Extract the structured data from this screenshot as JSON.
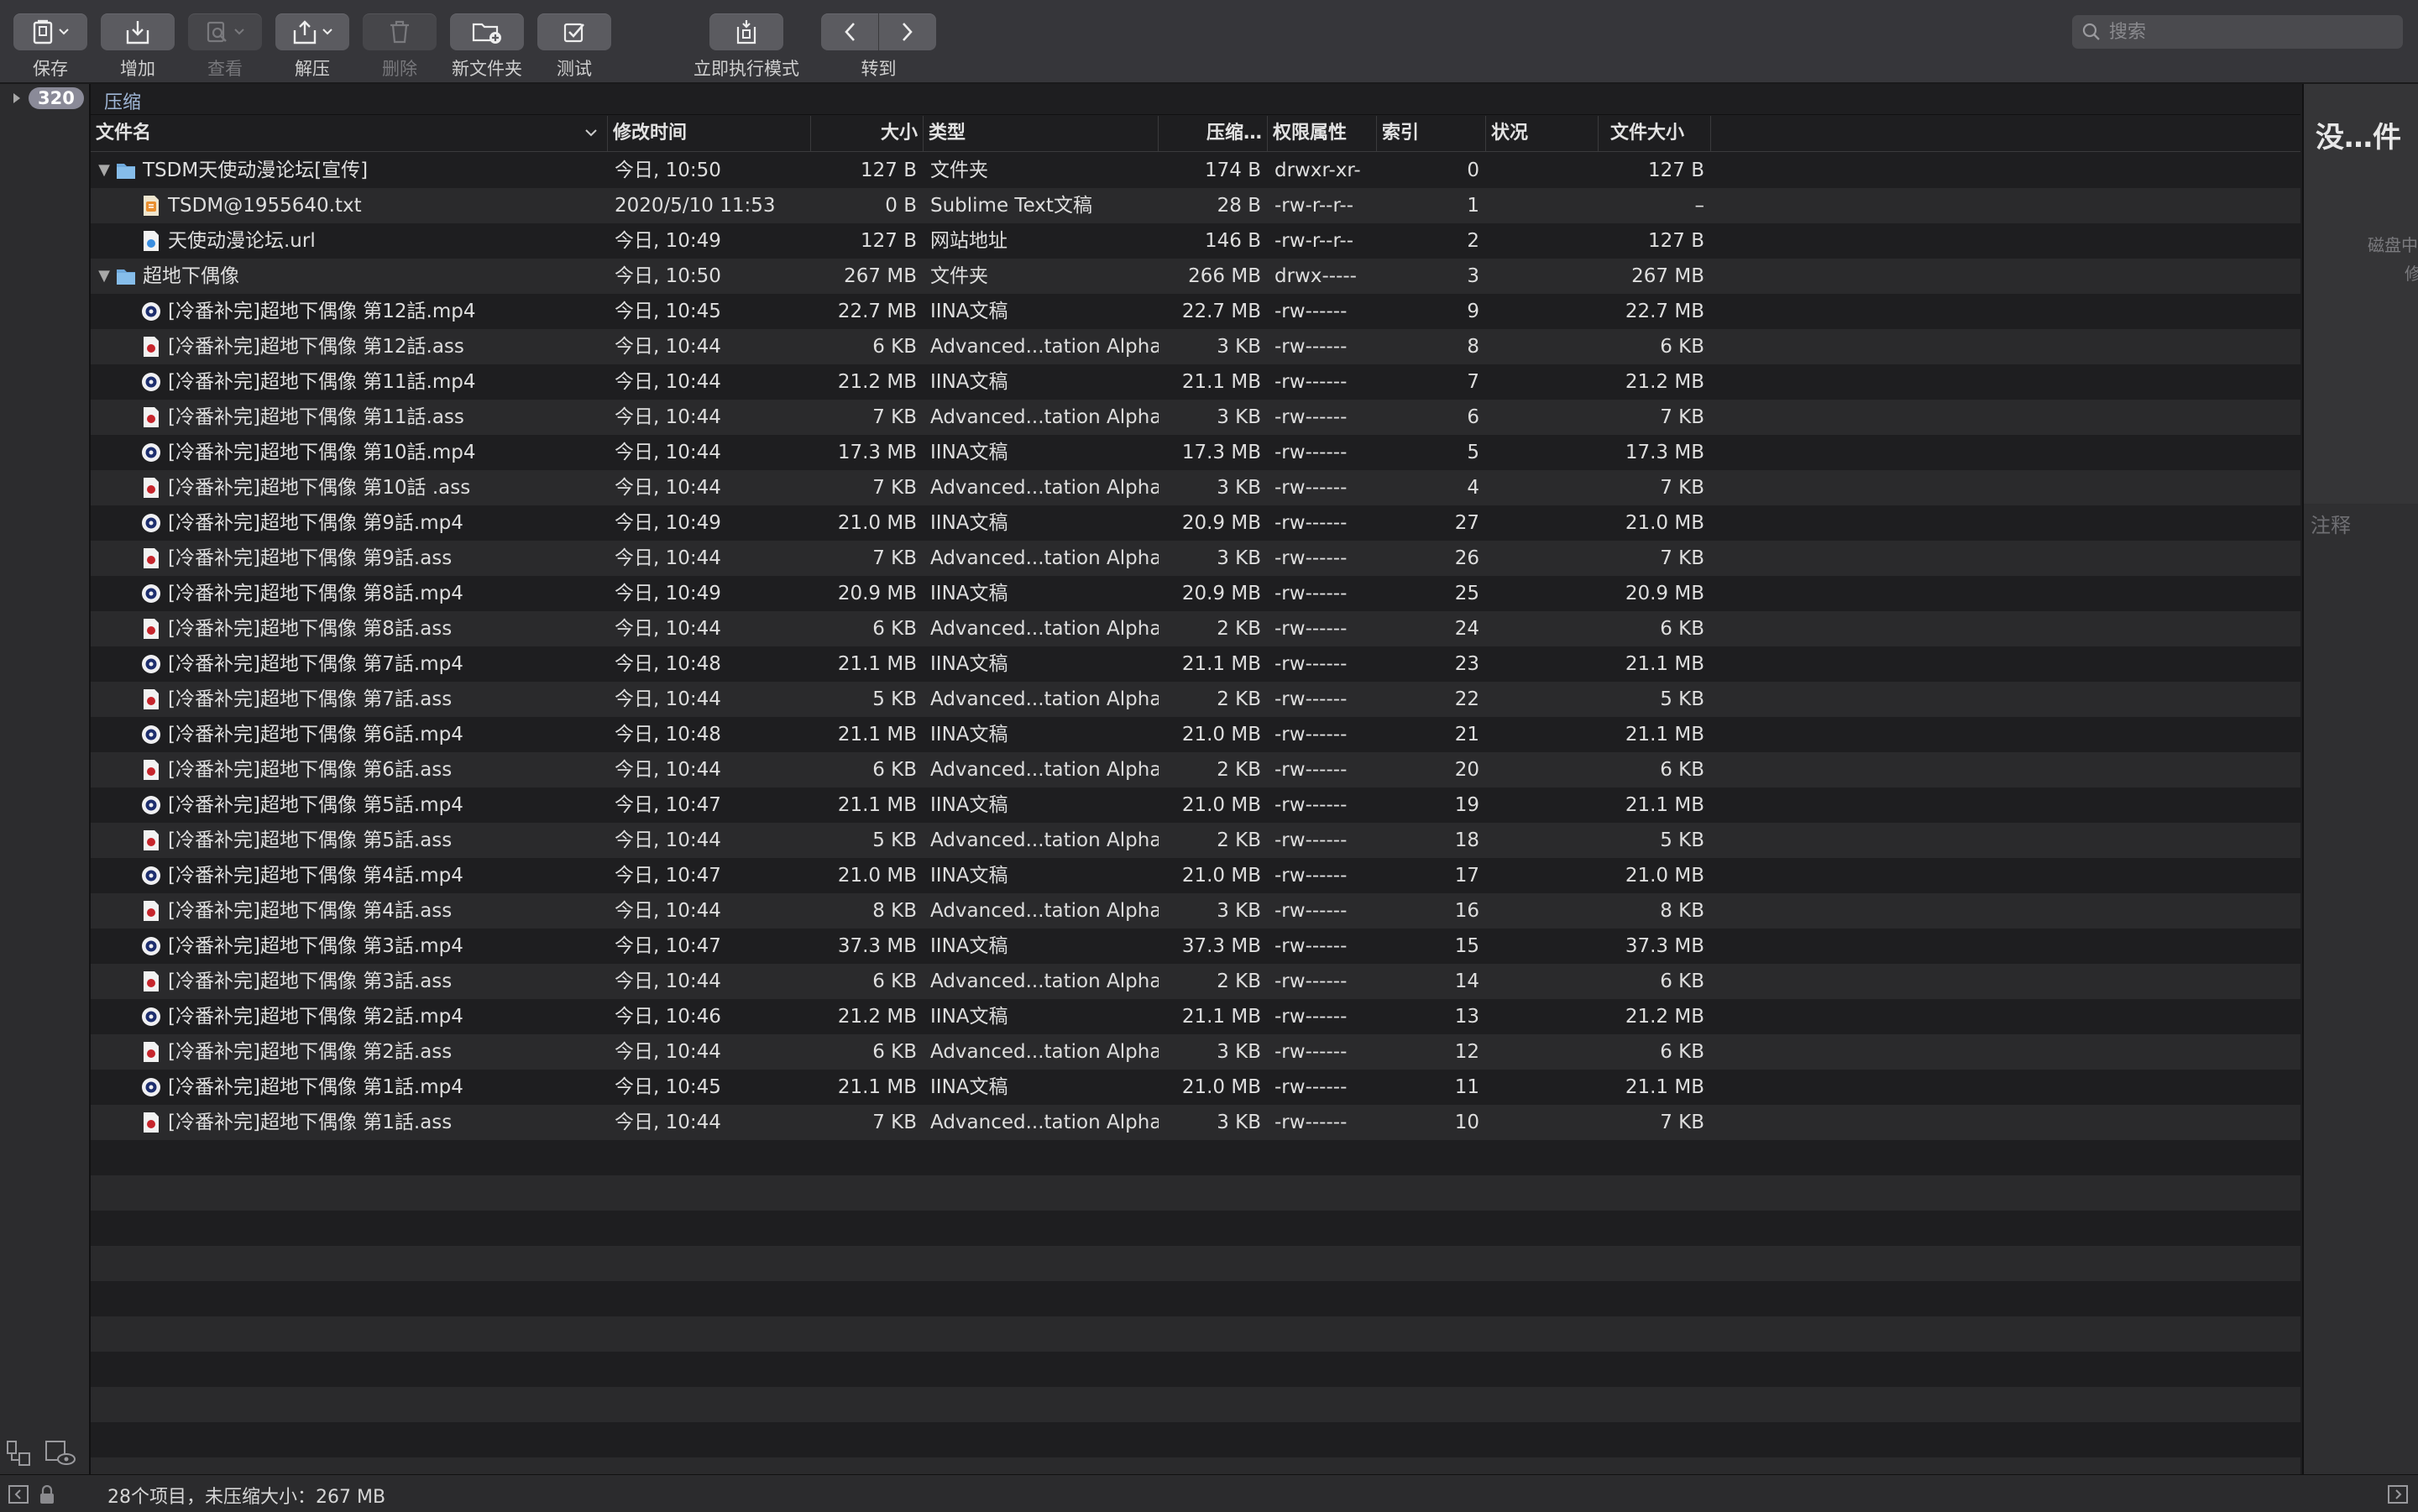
{
  "toolbar": {
    "save": "保存",
    "add": "增加",
    "view": "查看",
    "extract": "解压",
    "delete": "删除",
    "new_folder": "新文件夹",
    "test": "测试",
    "execute_mode": "立即执行模式",
    "goto": "转到"
  },
  "search": {
    "placeholder": "搜索"
  },
  "sidebar": {
    "badge": "320"
  },
  "breadcrumb": "压缩",
  "columns": {
    "name": "文件名",
    "modified": "修改时间",
    "size": "大小",
    "kind": "类型",
    "compressed": "压缩…",
    "permissions": "权限属性",
    "index": "索引",
    "status": "状况",
    "file_size": "文件大小"
  },
  "rows": [
    {
      "name": "TSDM天使动漫论坛[宣传]",
      "level": 0,
      "icon": "folder-icon",
      "expanded": true,
      "modified": "今日, 10:50",
      "size": "127 B",
      "kind": "文件夹",
      "compressed": "174 B",
      "perm": "drwxr-xr-",
      "index": "0",
      "status": "",
      "fsize": "127 B"
    },
    {
      "name": "TSDM@1955640.txt",
      "level": 1,
      "icon": "text-file-icon",
      "modified": "2020/5/10 11:53",
      "size": "0 B",
      "kind": "Sublime Text文稿",
      "compressed": "28 B",
      "perm": "-rw-r--r--",
      "index": "1",
      "status": "",
      "fsize": "–"
    },
    {
      "name": "天使动漫论坛.url",
      "level": 1,
      "icon": "url-file-icon",
      "modified": "今日, 10:49",
      "size": "127 B",
      "kind": "网站地址",
      "compressed": "146 B",
      "perm": "-rw-r--r--",
      "index": "2",
      "status": "",
      "fsize": "127 B"
    },
    {
      "name": "超地下偶像",
      "level": 0,
      "icon": "folder-icon",
      "expanded": true,
      "modified": "今日, 10:50",
      "size": "267 MB",
      "kind": "文件夹",
      "compressed": "266 MB",
      "perm": "drwx-----",
      "index": "3",
      "status": "",
      "fsize": "267 MB"
    },
    {
      "name": "[冷番补完]超地下偶像 第12話.mp4",
      "level": 1,
      "icon": "video-file-icon",
      "modified": "今日, 10:45",
      "size": "22.7 MB",
      "kind": "IINA文稿",
      "compressed": "22.7 MB",
      "perm": "-rw------",
      "index": "9",
      "status": "",
      "fsize": "22.7 MB"
    },
    {
      "name": "[冷番补完]超地下偶像 第12話.ass",
      "level": 1,
      "icon": "subtitle-file-icon",
      "modified": "今日, 10:44",
      "size": "6 KB",
      "kind": "Advanced...tation Alpha",
      "compressed": "3 KB",
      "perm": "-rw------",
      "index": "8",
      "status": "",
      "fsize": "6 KB"
    },
    {
      "name": "[冷番补完]超地下偶像 第11話.mp4",
      "level": 1,
      "icon": "video-file-icon",
      "modified": "今日, 10:44",
      "size": "21.2 MB",
      "kind": "IINA文稿",
      "compressed": "21.1 MB",
      "perm": "-rw------",
      "index": "7",
      "status": "",
      "fsize": "21.2 MB"
    },
    {
      "name": "[冷番补完]超地下偶像 第11話.ass",
      "level": 1,
      "icon": "subtitle-file-icon",
      "modified": "今日, 10:44",
      "size": "7 KB",
      "kind": "Advanced...tation Alpha",
      "compressed": "3 KB",
      "perm": "-rw------",
      "index": "6",
      "status": "",
      "fsize": "7 KB"
    },
    {
      "name": "[冷番补完]超地下偶像 第10話.mp4",
      "level": 1,
      "icon": "video-file-icon",
      "modified": "今日, 10:44",
      "size": "17.3 MB",
      "kind": "IINA文稿",
      "compressed": "17.3 MB",
      "perm": "-rw------",
      "index": "5",
      "status": "",
      "fsize": "17.3 MB"
    },
    {
      "name": "[冷番补完]超地下偶像 第10話 .ass",
      "level": 1,
      "icon": "subtitle-file-icon",
      "modified": "今日, 10:44",
      "size": "7 KB",
      "kind": "Advanced...tation Alpha",
      "compressed": "3 KB",
      "perm": "-rw------",
      "index": "4",
      "status": "",
      "fsize": "7 KB"
    },
    {
      "name": "[冷番补完]超地下偶像 第9話.mp4",
      "level": 1,
      "icon": "video-file-icon",
      "modified": "今日, 10:49",
      "size": "21.0 MB",
      "kind": "IINA文稿",
      "compressed": "20.9 MB",
      "perm": "-rw------",
      "index": "27",
      "status": "",
      "fsize": "21.0 MB"
    },
    {
      "name": "[冷番补完]超地下偶像 第9話.ass",
      "level": 1,
      "icon": "subtitle-file-icon",
      "modified": "今日, 10:44",
      "size": "7 KB",
      "kind": "Advanced...tation Alpha",
      "compressed": "3 KB",
      "perm": "-rw------",
      "index": "26",
      "status": "",
      "fsize": "7 KB"
    },
    {
      "name": "[冷番补完]超地下偶像 第8話.mp4",
      "level": 1,
      "icon": "video-file-icon",
      "modified": "今日, 10:49",
      "size": "20.9 MB",
      "kind": "IINA文稿",
      "compressed": "20.9 MB",
      "perm": "-rw------",
      "index": "25",
      "status": "",
      "fsize": "20.9 MB"
    },
    {
      "name": "[冷番补完]超地下偶像 第8話.ass",
      "level": 1,
      "icon": "subtitle-file-icon",
      "modified": "今日, 10:44",
      "size": "6 KB",
      "kind": "Advanced...tation Alpha",
      "compressed": "2 KB",
      "perm": "-rw------",
      "index": "24",
      "status": "",
      "fsize": "6 KB"
    },
    {
      "name": "[冷番补完]超地下偶像 第7話.mp4",
      "level": 1,
      "icon": "video-file-icon",
      "modified": "今日, 10:48",
      "size": "21.1 MB",
      "kind": "IINA文稿",
      "compressed": "21.1 MB",
      "perm": "-rw------",
      "index": "23",
      "status": "",
      "fsize": "21.1 MB"
    },
    {
      "name": "[冷番补完]超地下偶像 第7話.ass",
      "level": 1,
      "icon": "subtitle-file-icon",
      "modified": "今日, 10:44",
      "size": "5 KB",
      "kind": "Advanced...tation Alpha",
      "compressed": "2 KB",
      "perm": "-rw------",
      "index": "22",
      "status": "",
      "fsize": "5 KB"
    },
    {
      "name": "[冷番补完]超地下偶像 第6話.mp4",
      "level": 1,
      "icon": "video-file-icon",
      "modified": "今日, 10:48",
      "size": "21.1 MB",
      "kind": "IINA文稿",
      "compressed": "21.0 MB",
      "perm": "-rw------",
      "index": "21",
      "status": "",
      "fsize": "21.1 MB"
    },
    {
      "name": "[冷番补完]超地下偶像 第6話.ass",
      "level": 1,
      "icon": "subtitle-file-icon",
      "modified": "今日, 10:44",
      "size": "6 KB",
      "kind": "Advanced...tation Alpha",
      "compressed": "2 KB",
      "perm": "-rw------",
      "index": "20",
      "status": "",
      "fsize": "6 KB"
    },
    {
      "name": "[冷番补完]超地下偶像 第5話.mp4",
      "level": 1,
      "icon": "video-file-icon",
      "modified": "今日, 10:47",
      "size": "21.1 MB",
      "kind": "IINA文稿",
      "compressed": "21.0 MB",
      "perm": "-rw------",
      "index": "19",
      "status": "",
      "fsize": "21.1 MB"
    },
    {
      "name": "[冷番补完]超地下偶像 第5話.ass",
      "level": 1,
      "icon": "subtitle-file-icon",
      "modified": "今日, 10:44",
      "size": "5 KB",
      "kind": "Advanced...tation Alpha",
      "compressed": "2 KB",
      "perm": "-rw------",
      "index": "18",
      "status": "",
      "fsize": "5 KB"
    },
    {
      "name": "[冷番补完]超地下偶像 第4話.mp4",
      "level": 1,
      "icon": "video-file-icon",
      "modified": "今日, 10:47",
      "size": "21.0 MB",
      "kind": "IINA文稿",
      "compressed": "21.0 MB",
      "perm": "-rw------",
      "index": "17",
      "status": "",
      "fsize": "21.0 MB"
    },
    {
      "name": "[冷番补完]超地下偶像 第4話.ass",
      "level": 1,
      "icon": "subtitle-file-icon",
      "modified": "今日, 10:44",
      "size": "8 KB",
      "kind": "Advanced...tation Alpha",
      "compressed": "3 KB",
      "perm": "-rw------",
      "index": "16",
      "status": "",
      "fsize": "8 KB"
    },
    {
      "name": "[冷番补完]超地下偶像 第3話.mp4",
      "level": 1,
      "icon": "video-file-icon",
      "modified": "今日, 10:47",
      "size": "37.3 MB",
      "kind": "IINA文稿",
      "compressed": "37.3 MB",
      "perm": "-rw------",
      "index": "15",
      "status": "",
      "fsize": "37.3 MB"
    },
    {
      "name": "[冷番补完]超地下偶像 第3話.ass",
      "level": 1,
      "icon": "subtitle-file-icon",
      "modified": "今日, 10:44",
      "size": "6 KB",
      "kind": "Advanced...tation Alpha",
      "compressed": "2 KB",
      "perm": "-rw------",
      "index": "14",
      "status": "",
      "fsize": "6 KB"
    },
    {
      "name": "[冷番补完]超地下偶像 第2話.mp4",
      "level": 1,
      "icon": "video-file-icon",
      "modified": "今日, 10:46",
      "size": "21.2 MB",
      "kind": "IINA文稿",
      "compressed": "21.1 MB",
      "perm": "-rw------",
      "index": "13",
      "status": "",
      "fsize": "21.2 MB"
    },
    {
      "name": "[冷番补完]超地下偶像 第2話.ass",
      "level": 1,
      "icon": "subtitle-file-icon",
      "modified": "今日, 10:44",
      "size": "6 KB",
      "kind": "Advanced...tation Alpha",
      "compressed": "3 KB",
      "perm": "-rw------",
      "index": "12",
      "status": "",
      "fsize": "6 KB"
    },
    {
      "name": "[冷番补完]超地下偶像 第1話.mp4",
      "level": 1,
      "icon": "video-file-icon",
      "modified": "今日, 10:45",
      "size": "21.1 MB",
      "kind": "IINA文稿",
      "compressed": "21.0 MB",
      "perm": "-rw------",
      "index": "11",
      "status": "",
      "fsize": "21.1 MB"
    },
    {
      "name": "[冷番补完]超地下偶像 第1話.ass",
      "level": 1,
      "icon": "subtitle-file-icon",
      "modified": "今日, 10:44",
      "size": "7 KB",
      "kind": "Advanced...tation Alpha",
      "compressed": "3 KB",
      "perm": "-rw------",
      "index": "10",
      "status": "",
      "fsize": "7 KB"
    }
  ],
  "inspector": {
    "title": "没…件",
    "line1": "磁盘中",
    "line2": "修",
    "notes_label": "注释"
  },
  "status": "28个项目，未压缩大小：267 MB",
  "colors": {
    "background": "#1e1e20",
    "row_alt": "#2a2a2c",
    "folder_blue": "#6fa9dc",
    "toolbar": "#36363a"
  }
}
